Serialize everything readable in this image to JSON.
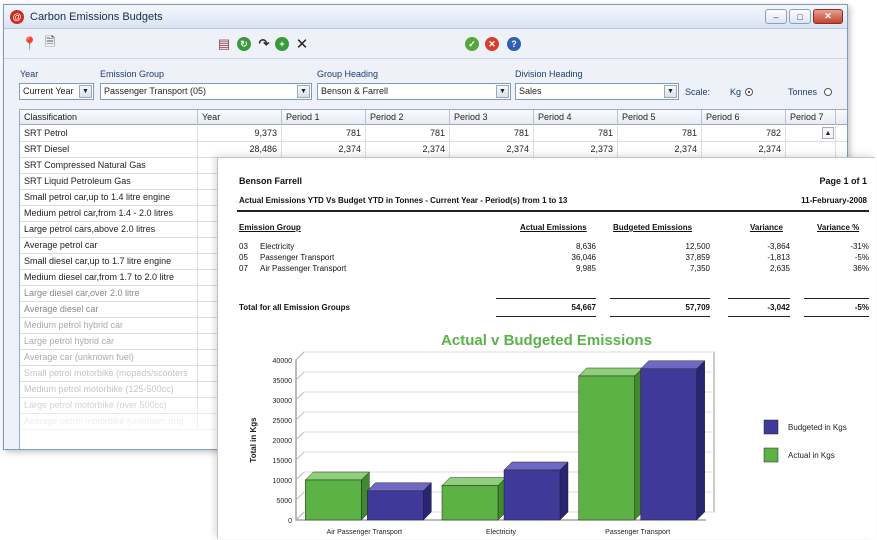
{
  "window": {
    "title": "Carbon Emissions Budgets",
    "app_icon": "app-logo-icon"
  },
  "toolbar": {
    "icons": [
      "properties-icon",
      "preview-icon",
      "print-icon",
      "refresh-icon",
      "redo-icon",
      "add-icon",
      "delete-icon",
      "approve-icon",
      "reject-icon",
      "help-icon"
    ]
  },
  "filters": {
    "year_label": "Year",
    "year_value": "Current Year",
    "emission_group_label": "Emission Group",
    "emission_group_value": "Passenger Transport (05)",
    "group_heading_label": "Group Heading",
    "group_heading_value": "Benson & Farrell",
    "division_heading_label": "Division Heading",
    "division_heading_value": "Sales",
    "scale_label": "Scale:",
    "scale_kg": "Kg",
    "scale_tonnes": "Tonnes",
    "scale_selected": "Kg"
  },
  "grid": {
    "columns": [
      "Classification",
      "Year",
      "Period 1",
      "Period 2",
      "Period 3",
      "Period 4",
      "Period 5",
      "Period 6",
      "Period 7"
    ],
    "rows": [
      {
        "label": "SRT Petrol",
        "values": [
          "9,373",
          "781",
          "781",
          "781",
          "781",
          "781",
          "782"
        ]
      },
      {
        "label": "SRT Diesel",
        "values": [
          "28,486",
          "2,374",
          "2,374",
          "2,374",
          "2,373",
          "2,374",
          "2,374"
        ]
      },
      {
        "label": "SRT Compressed Natural Gas",
        "values": []
      },
      {
        "label": "SRT Liquid Petroleum Gas",
        "values": []
      },
      {
        "label": "Small petrol car,up to 1.4 litre engine",
        "values": []
      },
      {
        "label": "Medium petrol car,from 1.4 - 2.0 litres",
        "values": []
      },
      {
        "label": "Large petrol cars,above 2.0 litres",
        "values": []
      },
      {
        "label": "Average petrol car",
        "values": []
      },
      {
        "label": "Small diesel car,up to 1.7 litre engine",
        "values": []
      },
      {
        "label": "Medium diesel car,from 1.7 to 2.0 litre",
        "values": []
      },
      {
        "label": "Large diesel car,over 2.0 litre",
        "values": []
      },
      {
        "label": "Average diesel car",
        "values": []
      },
      {
        "label": "Medium petrol hybrid car",
        "values": []
      },
      {
        "label": "Large petrol hybrid car",
        "values": []
      },
      {
        "label": "Average car (unknown fuel)",
        "values": []
      },
      {
        "label": "Small petrol motorbike (mopeds/scooters",
        "values": []
      },
      {
        "label": "Medium petrol motorbike (125-500cc)",
        "values": []
      },
      {
        "label": "Large petrol motorbike (over 500cc)",
        "values": []
      },
      {
        "label": "Average petrol motorbike (unknown eng",
        "values": []
      }
    ]
  },
  "report": {
    "company": "Benson Farrell",
    "page": "Page 1 of 1",
    "heading": "Actual Emissions YTD Vs Budget YTD in Tonnes  - Current Year - Period(s) from 1 to 13",
    "date": "11-February-2008",
    "columns": [
      "Emission Group",
      "Actual Emissions",
      "Budgeted Emissions",
      "Variance",
      "Variance %"
    ],
    "rows": [
      {
        "code": "03",
        "name": "Electricity",
        "actual": "8,636",
        "budget": "12,500",
        "variance": "-3,864",
        "pct": "-31%"
      },
      {
        "code": "05",
        "name": "Passenger Transport",
        "actual": "36,046",
        "budget": "37,859",
        "variance": "-1,813",
        "pct": "-5%"
      },
      {
        "code": "07",
        "name": "Air Passenger Transport",
        "actual": "9,985",
        "budget": "7,350",
        "variance": "2,635",
        "pct": "36%"
      }
    ],
    "total": {
      "label": "Total for all Emission Groups",
      "actual": "54,667",
      "budget": "57,709",
      "variance": "-3,042",
      "pct": "-5%"
    }
  },
  "chart_data": {
    "type": "bar",
    "title": "Actual v Budgeted Emissions",
    "ylabel": "Total in Kgs",
    "xlabel": "",
    "categories": [
      "Air Passenger Transport",
      "Electricity",
      "Passenger Transport"
    ],
    "series": [
      {
        "name": "Actual in Kgs",
        "values": [
          10000,
          8600,
          36000
        ],
        "color": "#5db245"
      },
      {
        "name": "Budgeted in Kgs",
        "values": [
          7300,
          12500,
          37800
        ],
        "color": "#3f3a99"
      }
    ],
    "ylim": [
      0,
      40000
    ],
    "yticks": [
      "0",
      "5000",
      "10000",
      "15000",
      "20000",
      "25000",
      "30000",
      "35000",
      "40000"
    ],
    "legend": "right",
    "legend_order": [
      "Budgeted in Kgs",
      "Actual in Kgs"
    ],
    "grid": true
  }
}
